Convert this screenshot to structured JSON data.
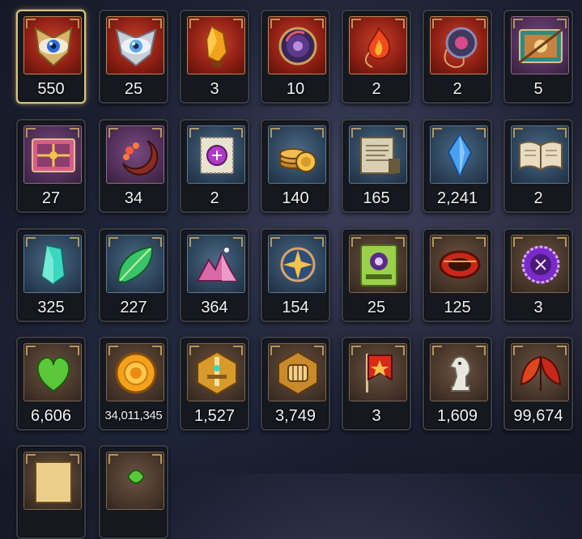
{
  "inventory": {
    "items": [
      {
        "name": "eye-emblem",
        "qty": "550",
        "bg": "red",
        "selected": true
      },
      {
        "name": "silver-eye-emblem",
        "qty": "25",
        "bg": "red"
      },
      {
        "name": "amber-crystal",
        "qty": "3",
        "bg": "red"
      },
      {
        "name": "purple-disc",
        "qty": "10",
        "bg": "red"
      },
      {
        "name": "flame-pendant",
        "qty": "2",
        "bg": "red"
      },
      {
        "name": "disc-pendant",
        "qty": "2",
        "bg": "red"
      },
      {
        "name": "card-pack",
        "qty": "5",
        "bg": "purple"
      },
      {
        "name": "gift-card-pack",
        "qty": "27",
        "bg": "purple"
      },
      {
        "name": "crescent-charm",
        "qty": "34",
        "bg": "purple"
      },
      {
        "name": "stamp-ticket",
        "qty": "2",
        "bg": "blue"
      },
      {
        "name": "gold-coins",
        "qty": "140",
        "bg": "blue"
      },
      {
        "name": "scroll",
        "qty": "165",
        "bg": "blue"
      },
      {
        "name": "blue-crystal",
        "qty": "2,241",
        "bg": "blue"
      },
      {
        "name": "open-book",
        "qty": "2",
        "bg": "blue"
      },
      {
        "name": "teal-crystal",
        "qty": "325",
        "bg": "blue"
      },
      {
        "name": "green-leaf",
        "qty": "227",
        "bg": "blue"
      },
      {
        "name": "pink-crystal-pile",
        "qty": "364",
        "bg": "blue"
      },
      {
        "name": "star-amulet",
        "qty": "154",
        "bg": "blue"
      },
      {
        "name": "green-card",
        "qty": "25",
        "bg": "brown"
      },
      {
        "name": "red-bracelet",
        "qty": "125",
        "bg": "brown"
      },
      {
        "name": "purple-seal",
        "qty": "3",
        "bg": "brown"
      },
      {
        "name": "green-heart",
        "qty": "6,606",
        "bg": "brown"
      },
      {
        "name": "sun-coin",
        "qty": "34,011,345",
        "bg": "brown",
        "small": true
      },
      {
        "name": "sword-badge",
        "qty": "1,527",
        "bg": "brown"
      },
      {
        "name": "fist-badge",
        "qty": "3,749",
        "bg": "brown"
      },
      {
        "name": "red-banner",
        "qty": "3",
        "bg": "brown"
      },
      {
        "name": "knight-chess-piece",
        "qty": "1,609",
        "bg": "brown"
      },
      {
        "name": "red-leaf-pair",
        "qty": "99,674",
        "bg": "brown"
      },
      {
        "name": "partial-item-1",
        "qty": "",
        "bg": "brown"
      },
      {
        "name": "partial-item-2",
        "qty": "",
        "bg": "brown"
      }
    ]
  }
}
